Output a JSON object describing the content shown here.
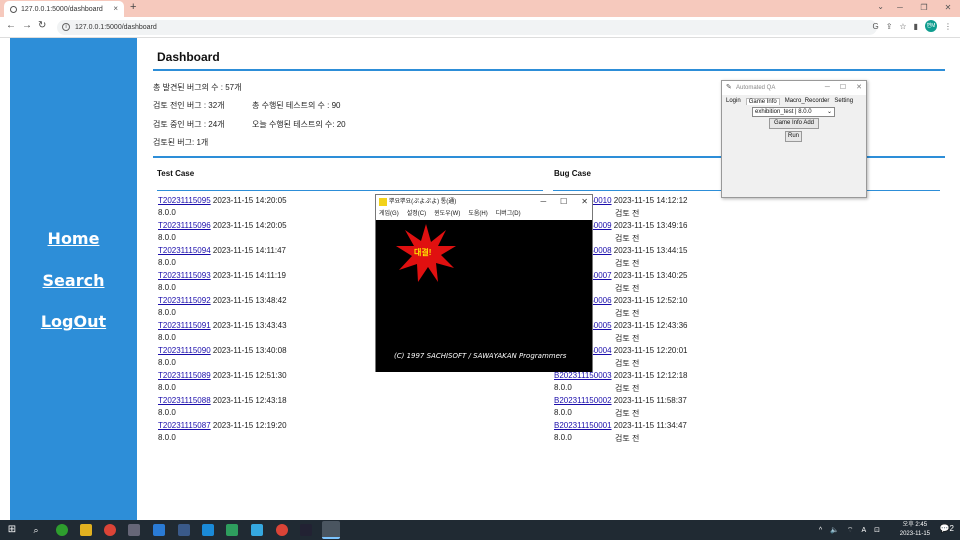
{
  "browser": {
    "tab_title": "127.0.0.1:5000/dashboard",
    "tab_close": "×",
    "new_tab": "+",
    "url": "127.0.0.1:5000/dashboard",
    "profile_initials": "변M"
  },
  "sidebar": {
    "home": "Home",
    "search": "Search",
    "logout": "LogOut",
    "bg_color": "#2d8ed8"
  },
  "dashboard": {
    "title": "Dashboard",
    "stats": {
      "total_bugs": "총 발견된 버그의 수 : 57개",
      "pre_review": "검토 전인 버그 : 32개",
      "total_tests": "총 수행된 테스트의 수 : 90",
      "in_review": "검토 중인 버그 : 24개",
      "today_tests": "오늘 수행된 테스트의 수: 20",
      "reviewed": "검토된 버그: 1개"
    },
    "test_case_title": "Test Case",
    "bug_case_title": "Bug Case",
    "test_cases": [
      {
        "id": "T20231115095",
        "time": "2023-11-15 14:20:05",
        "version": "8.0.0"
      },
      {
        "id": "T20231115096",
        "time": "2023-11-15 14:20:05",
        "version": "8.0.0"
      },
      {
        "id": "T20231115094",
        "time": "2023-11-15 14:11:47",
        "version": "8.0.0"
      },
      {
        "id": "T20231115093",
        "time": "2023-11-15 14:11:19",
        "version": "8.0.0"
      },
      {
        "id": "T20231115092",
        "time": "2023-11-15 13:48:42",
        "version": "8.0.0"
      },
      {
        "id": "T20231115091",
        "time": "2023-11-15 13:43:43",
        "version": "8.0.0"
      },
      {
        "id": "T20231115090",
        "time": "2023-11-15 13:40:08",
        "version": "8.0.0"
      },
      {
        "id": "T20231115089",
        "time": "2023-11-15 12:51:30",
        "version": "8.0.0"
      },
      {
        "id": "T20231115088",
        "time": "2023-11-15 12:43:18",
        "version": "8.0.0"
      },
      {
        "id": "T20231115087",
        "time": "2023-11-15 12:19:20",
        "version": "8.0.0"
      }
    ],
    "bug_cases": [
      {
        "id": "B202311150010",
        "time": "2023-11-15 14:12:12",
        "status": "검토 전"
      },
      {
        "id": "B202311150009",
        "time": "2023-11-15 13:49:16",
        "status": "검토 전"
      },
      {
        "id": "B202311150008",
        "time": "2023-11-15 13:44:15",
        "status": "검토 전"
      },
      {
        "id": "B202311150007",
        "time": "2023-11-15 13:40:25",
        "status": "검토 전"
      },
      {
        "id": "B202311150006",
        "time": "2023-11-15 12:52:10",
        "status": "검토 전"
      },
      {
        "id": "B202311150005",
        "time": "2023-11-15 12:43:36",
        "status": "검토 전"
      },
      {
        "id": "B202311150004",
        "time": "2023-11-15 12:20:01",
        "status": "검토 전"
      },
      {
        "id": "B202311150003",
        "time": "2023-11-15 12:12:18",
        "version": "8.0.0",
        "status": "검토 전"
      },
      {
        "id": "B202311150002",
        "time": "2023-11-15 11:58:37",
        "version": "8.0.0",
        "status": "검토 전"
      },
      {
        "id": "B202311150001",
        "time": "2023-11-15 11:34:47",
        "version": "8.0.0",
        "status": "검토 전"
      }
    ]
  },
  "qa_window": {
    "title": "Automated QA",
    "tabs": [
      "Login",
      "Game Info",
      "Macro_Recorder",
      "Setting"
    ],
    "select_value": "exhibition_test | 8.0.0",
    "add_button": "Game Info Add",
    "run_button": "Run"
  },
  "game_window": {
    "title": "뿌요뿌요(ぷよぷよ) 통(通)",
    "menu": [
      "게임(G)",
      "설정(C)",
      "윈도우(W)",
      "도움(H)",
      "디버그(D)"
    ],
    "burst_text": "대결!",
    "copyright": "(C) 1997 SACHISOFT / SAWAYAKAN Programmers"
  },
  "taskbar": {
    "time": "오후 2:45",
    "date": "2023-11-15",
    "notif_count": "2",
    "lang": "A"
  }
}
